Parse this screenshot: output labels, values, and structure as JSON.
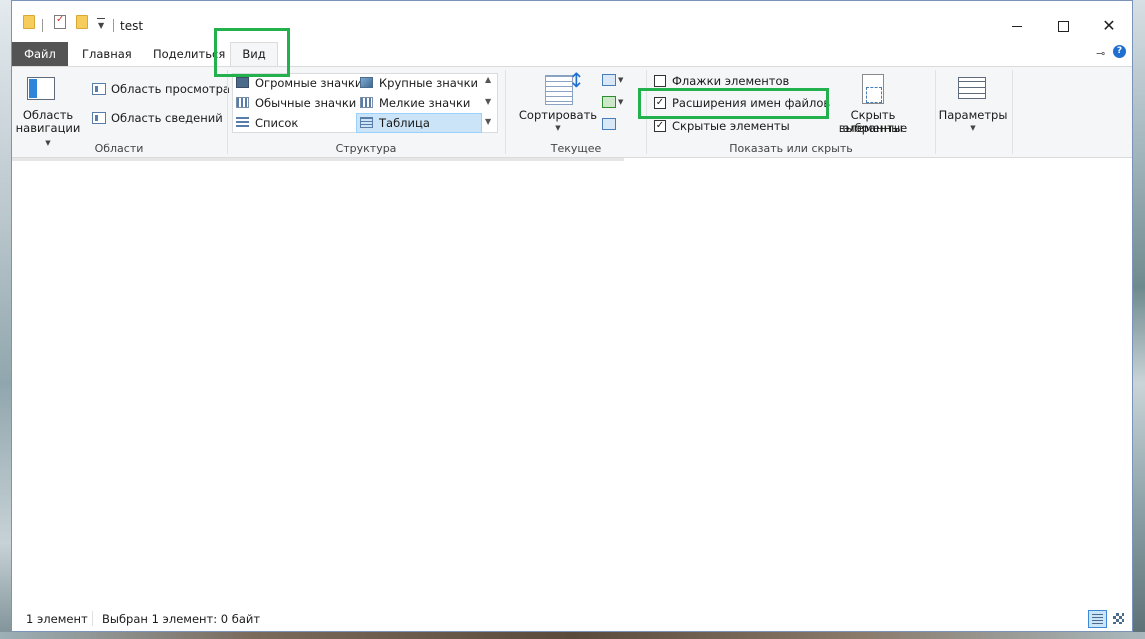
{
  "window": {
    "title": "test",
    "controls": {
      "minimize": "minimize",
      "maximize": "maximize",
      "close": "✕"
    }
  },
  "tabs": [
    {
      "label": "Файл"
    },
    {
      "label": "Главная"
    },
    {
      "label": "Поделиться"
    },
    {
      "label": "Вид",
      "active": true
    }
  ],
  "ribbon": {
    "panes": {
      "nav_pane": {
        "line1": "Область",
        "line2": "навигации"
      },
      "preview_pane": "Область просмотра",
      "details_pane": "Область сведений",
      "group_label": "Области"
    },
    "layout": {
      "items": [
        {
          "label": "Огромные значки",
          "icon": "huge-icons-icon"
        },
        {
          "label": "Крупные значки",
          "icon": "large-icons-icon"
        },
        {
          "label": "Обычные значки",
          "icon": "medium-icons-icon"
        },
        {
          "label": "Мелкие значки",
          "icon": "small-icons-icon"
        },
        {
          "label": "Список",
          "icon": "list-icon"
        },
        {
          "label": "Таблица",
          "icon": "details-icon",
          "selected": true
        }
      ],
      "group_label": "Структура"
    },
    "current_view": {
      "sort_label": "Сортировать",
      "group_label": "Текущее представление"
    },
    "show_hide": {
      "checkboxes": [
        {
          "label": "Флажки элементов",
          "checked": false
        },
        {
          "label": "Расширения имен файлов",
          "checked": true
        },
        {
          "label": "Скрытые элементы",
          "checked": true
        }
      ],
      "hide_selected": {
        "line1": "Скрыть выбранные",
        "line2": "элементы"
      },
      "group_label": "Показать или скрыть"
    },
    "options": {
      "label": "Параметры"
    }
  },
  "statusbar": {
    "count": "1 элемент",
    "selection": "Выбран 1 элемент: 0 байт"
  },
  "annotations": {
    "color": "#22b14c"
  },
  "colors": {
    "file_tab": "#545454",
    "selected_item": "#cce4f7",
    "help": "#1f6fd0"
  }
}
